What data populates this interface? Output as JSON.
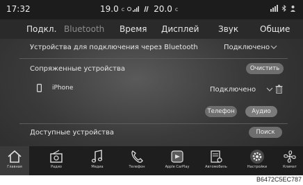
{
  "status": {
    "time": "17:32",
    "temp_left": "19.0",
    "temp_unit_left": "c",
    "temp_right": "20.0",
    "temp_unit_right": "c"
  },
  "tabs": [
    {
      "label": "Подкл."
    },
    {
      "label": "Bluetooth"
    },
    {
      "label": "Время"
    },
    {
      "label": "Дисплей"
    },
    {
      "label": "Звук"
    },
    {
      "label": "Общие"
    }
  ],
  "bt_connect": {
    "label": "Устройства для подключения через Bluetooth",
    "value": "Подключено"
  },
  "paired": {
    "label": "Сопряженные устройства",
    "clear_button": "Очистить",
    "device_name": "iPhone",
    "device_status": "Подключено",
    "phone_button": "Телефон",
    "audio_button": "Аудио"
  },
  "available": {
    "label": "Доступные устройства",
    "search_button": "Поиск"
  },
  "nav": [
    {
      "label": "Главная",
      "icon": "home-icon"
    },
    {
      "label": "Радио",
      "icon": "radio-icon"
    },
    {
      "label": "Медиа",
      "icon": "music-note-icon"
    },
    {
      "label": "Телефон",
      "icon": "phone-icon"
    },
    {
      "label": "Apple CarPlay",
      "icon": "carplay-icon"
    },
    {
      "label": "Автомобиль",
      "icon": "vehicle-icon"
    },
    {
      "label": "Настройки",
      "icon": "gear-icon"
    },
    {
      "label": "Климат",
      "icon": "fan-icon"
    }
  ],
  "caption": "B6472C5EC787"
}
